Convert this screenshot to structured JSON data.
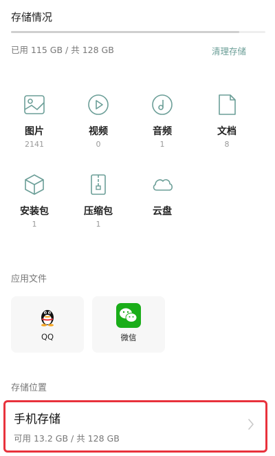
{
  "storage": {
    "title": "存储情况",
    "usage": "已用 115 GB / 共 128 GB",
    "used_fraction": 0.8984,
    "clean_label": "清理存储"
  },
  "categories": [
    {
      "label": "图片",
      "count": "2141",
      "icon": "image-icon"
    },
    {
      "label": "视频",
      "count": "0",
      "icon": "video-icon"
    },
    {
      "label": "音频",
      "count": "1",
      "icon": "music-icon"
    },
    {
      "label": "文档",
      "count": "8",
      "icon": "document-icon"
    },
    {
      "label": "安装包",
      "count": "1",
      "icon": "package-icon"
    },
    {
      "label": "压缩包",
      "count": "1",
      "icon": "zip-icon"
    },
    {
      "label": "云盘",
      "icon": "cloud-icon"
    }
  ],
  "app_files": {
    "title": "应用文件",
    "apps": [
      {
        "label": "QQ",
        "icon": "qq-icon"
      },
      {
        "label": "微信",
        "icon": "wechat-icon"
      }
    ]
  },
  "location": {
    "title": "存储位置",
    "item_title": "手机存储",
    "item_sub": "可用 13.2 GB / 共 128 GB"
  },
  "colors": {
    "accent": "#6b9e97",
    "highlight": "#e8323c",
    "wechat": "#1aad19"
  }
}
